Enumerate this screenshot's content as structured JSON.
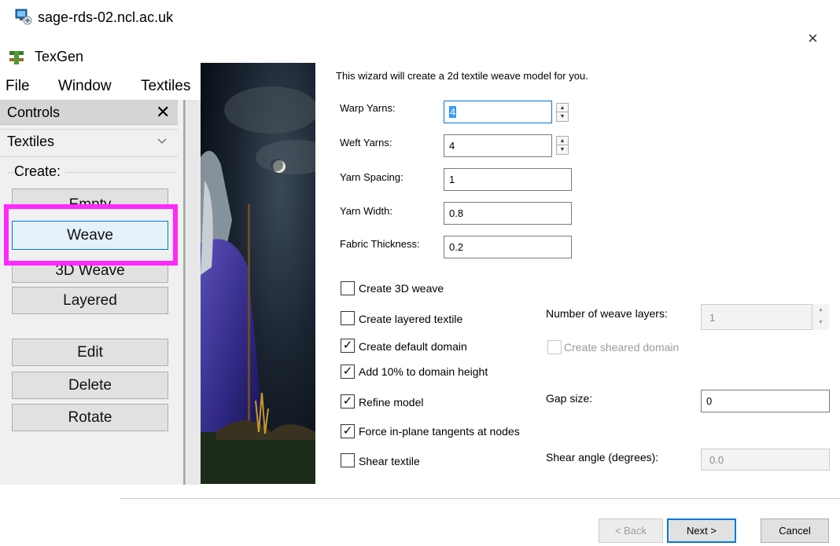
{
  "remote_desktop": {
    "title": "sage-rds-02.ncl.ac.uk",
    "icon": "remote-desktop-icon"
  },
  "app": {
    "title": "TexGen",
    "icon": "texgen-logo-icon",
    "menu": [
      "File",
      "Window",
      "Textiles"
    ]
  },
  "controls_panel": {
    "header": "Controls",
    "close_glyph": "✕",
    "dropdown_value": "Textiles",
    "group_label": "Create:",
    "create_buttons": [
      "Empty",
      "Weave",
      "3D Weave",
      "Layered"
    ],
    "edit_buttons": [
      "Edit",
      "Delete",
      "Rotate"
    ],
    "highlighted": "Weave"
  },
  "wizard": {
    "close_glyph": "×",
    "intro": "This wizard will create a 2d textile weave model for you.",
    "fields": [
      {
        "label": "Warp Yarns:",
        "value": "4"
      },
      {
        "label": "Weft Yarns:",
        "value": "4"
      },
      {
        "label": "Yarn Spacing:",
        "value": "1"
      },
      {
        "label": "Yarn Width:",
        "value": "0.8"
      },
      {
        "label": "Fabric Thickness:",
        "value": "0.2"
      }
    ],
    "options": [
      {
        "label": "Create 3D weave",
        "checked": false
      },
      {
        "label": "Create layered textile",
        "checked": false
      },
      {
        "label": "Create default domain",
        "checked": true
      },
      {
        "label": "Add 10% to domain height",
        "checked": true
      },
      {
        "label": "Refine model",
        "checked": true
      },
      {
        "label": "Force in-plane tangents at nodes",
        "checked": true
      },
      {
        "label": "Shear textile",
        "checked": false
      }
    ],
    "num_layers": {
      "label": "Number of weave layers:",
      "value": "1"
    },
    "sheared_domain": {
      "label": "Create sheared domain",
      "checked": false
    },
    "gap": {
      "label": "Gap size:",
      "value": "0"
    },
    "shear_angle": {
      "label": "Shear angle (degrees):",
      "value": "0.0"
    },
    "buttons": {
      "back": "< Back",
      "next": "Next >",
      "cancel": "Cancel"
    }
  },
  "colors": {
    "highlight": "#ff28ff",
    "focus": "#0078d7",
    "selection": "#3399ff"
  }
}
